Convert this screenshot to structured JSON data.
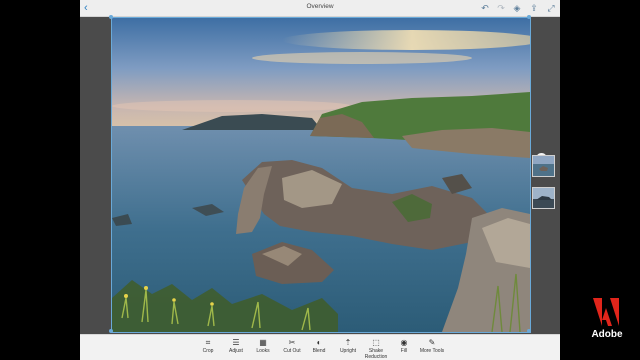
{
  "header": {
    "title": "Overview",
    "back_icon": "chevron-left-icon"
  },
  "header_actions": [
    {
      "name": "undo-icon",
      "glyph": "↶"
    },
    {
      "name": "redo-icon",
      "glyph": "↷"
    },
    {
      "name": "layers-icon",
      "glyph": "◈"
    },
    {
      "name": "share-icon",
      "glyph": "⇪"
    },
    {
      "name": "fullscreen-icon",
      "glyph": "⤢"
    }
  ],
  "side_panel": {
    "add_glyph": "+"
  },
  "toolbar": {
    "crop": "Crop",
    "adjust": "Adjust",
    "looks": "Looks",
    "cutout": "Cut Out",
    "blend": "Blend",
    "upright": "Upright",
    "shake_line1": "Shake",
    "shake_line2": "Reduction",
    "fill": "Fill",
    "more": "More Tools"
  },
  "brand": {
    "word": "Adobe",
    "color": "#e1251b"
  },
  "colors": {
    "accent": "#6aa9d8",
    "topbar": "#eeeeee",
    "canvas": "#4b4b4b"
  }
}
